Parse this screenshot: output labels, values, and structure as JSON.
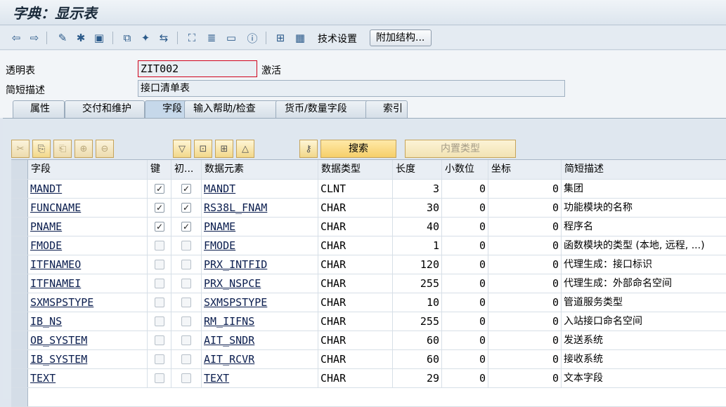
{
  "window": {
    "title": "字典：显示表"
  },
  "toolbar": {
    "tech_settings": "技术设置",
    "append_structure": "附加结构..."
  },
  "header": {
    "table_label": "透明表",
    "table_value": "ZIT002",
    "status": "激活",
    "desc_label": "简短描述",
    "desc_value": "接口清单表"
  },
  "tabs": [
    {
      "label": "属性"
    },
    {
      "label": "交付和维护"
    },
    {
      "label": "字段"
    },
    {
      "label": "输入帮助/检查"
    },
    {
      "label": "货币/数量字段"
    },
    {
      "label": "索引"
    }
  ],
  "panel": {
    "search_label": "搜索",
    "builtin_label": "内置类型"
  },
  "columns": [
    "字段",
    "键",
    "初...",
    "数据元素",
    "数据类型",
    "长度",
    "小数位",
    "坐标",
    "简短描述"
  ],
  "rows": [
    {
      "field": "MANDT",
      "key": true,
      "init": true,
      "elem": "MANDT",
      "type": "CLNT",
      "len": "3",
      "dec": "0",
      "coord": "0",
      "desc": "集团"
    },
    {
      "field": "FUNCNAME",
      "key": true,
      "init": true,
      "elem": "RS38L_FNAM",
      "type": "CHAR",
      "len": "30",
      "dec": "0",
      "coord": "0",
      "desc": "功能模块的名称"
    },
    {
      "field": "PNAME",
      "key": true,
      "init": true,
      "elem": "PNAME",
      "type": "CHAR",
      "len": "40",
      "dec": "0",
      "coord": "0",
      "desc": "程序名"
    },
    {
      "field": "FMODE",
      "key": false,
      "init": false,
      "elem": "FMODE",
      "type": "CHAR",
      "len": "1",
      "dec": "0",
      "coord": "0",
      "desc": "函数模块的类型 (本地, 远程, ...)"
    },
    {
      "field": "ITFNAMEO",
      "key": false,
      "init": false,
      "elem": "PRX_INTFID",
      "type": "CHAR",
      "len": "120",
      "dec": "0",
      "coord": "0",
      "desc": "代理生成：接口标识"
    },
    {
      "field": "ITFNAMEI",
      "key": false,
      "init": false,
      "elem": "PRX_NSPCE",
      "type": "CHAR",
      "len": "255",
      "dec": "0",
      "coord": "0",
      "desc": "代理生成：外部命名空间"
    },
    {
      "field": "SXMSPSTYPE",
      "key": false,
      "init": false,
      "elem": "SXMSPSTYPE",
      "type": "CHAR",
      "len": "10",
      "dec": "0",
      "coord": "0",
      "desc": "管道服务类型"
    },
    {
      "field": "IB_NS",
      "key": false,
      "init": false,
      "elem": "RM_IIFNS",
      "type": "CHAR",
      "len": "255",
      "dec": "0",
      "coord": "0",
      "desc": "入站接口命名空间"
    },
    {
      "field": "OB_SYSTEM",
      "key": false,
      "init": false,
      "elem": "AIT_SNDR",
      "type": "CHAR",
      "len": "60",
      "dec": "0",
      "coord": "0",
      "desc": "发送系统"
    },
    {
      "field": "IB_SYSTEM",
      "key": false,
      "init": false,
      "elem": "AIT_RCVR",
      "type": "CHAR",
      "len": "60",
      "dec": "0",
      "coord": "0",
      "desc": "接收系统"
    },
    {
      "field": "TEXT",
      "key": false,
      "init": false,
      "elem": "TEXT",
      "type": "CHAR",
      "len": "29",
      "dec": "0",
      "coord": "0",
      "desc": "文本字段"
    }
  ],
  "icons": {
    "check_mark": "✓"
  }
}
